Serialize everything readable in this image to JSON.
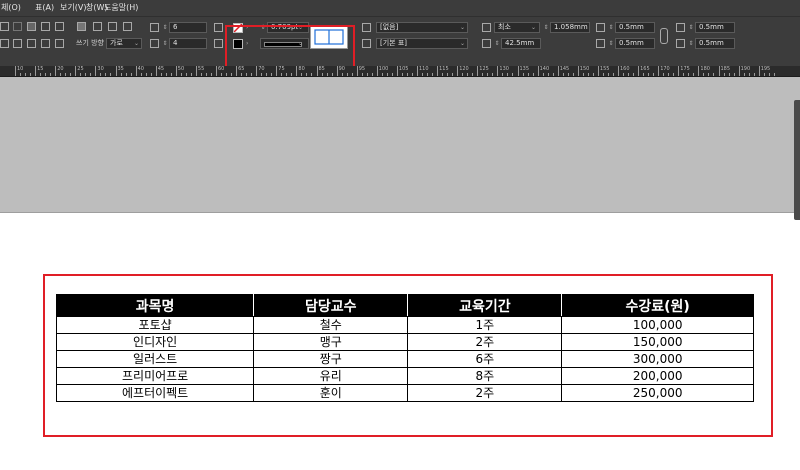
{
  "menu": [
    "체(O)",
    "표(A)",
    "보기(V)",
    "창(W)",
    "도움말(H)"
  ],
  "control_bar": {
    "rows_value": "6",
    "columns_value": "4",
    "writing_direction_label": "쓰기 방향",
    "writing_direction_value": "가로",
    "stroke_weight": "0.709pt",
    "cell_style": "[없음]",
    "table_style": "[기본 표]",
    "row_height_mode": "최소",
    "row_height_value": "1.058mm",
    "column_width_value": "42.5mm",
    "inset_top": "0.5mm",
    "inset_bottom": "0.5mm",
    "inset_left": "0.5mm",
    "inset_right": "0.5mm"
  },
  "ruler": [
    "10",
    "15",
    "20",
    "25",
    "30",
    "35",
    "40",
    "45",
    "50",
    "55",
    "60",
    "65",
    "70",
    "75",
    "80",
    "85",
    "90",
    "95",
    "100",
    "105",
    "110",
    "115",
    "120",
    "125",
    "130",
    "135",
    "140",
    "145",
    "150",
    "155",
    "160",
    "165",
    "170",
    "175",
    "180",
    "185",
    "190",
    "195"
  ],
  "table": {
    "headers": [
      "과목명",
      "담당교수",
      "교육기간",
      "수강료(원)"
    ],
    "rows": [
      [
        "포토샵",
        "철수",
        "1주",
        "100,000"
      ],
      [
        "인디자인",
        "맹구",
        "2주",
        "150,000"
      ],
      [
        "일러스트",
        "짱구",
        "6주",
        "300,000"
      ],
      [
        "프리미어프로",
        "유리",
        "8주",
        "200,000"
      ],
      [
        "에프터이펙트",
        "훈이",
        "2주",
        "250,000"
      ]
    ]
  },
  "colors": {
    "highlight": "#e01e26",
    "panel": "#3c3c3c",
    "pasteboard": "#bdbdbd",
    "header_bg": "#000000"
  }
}
